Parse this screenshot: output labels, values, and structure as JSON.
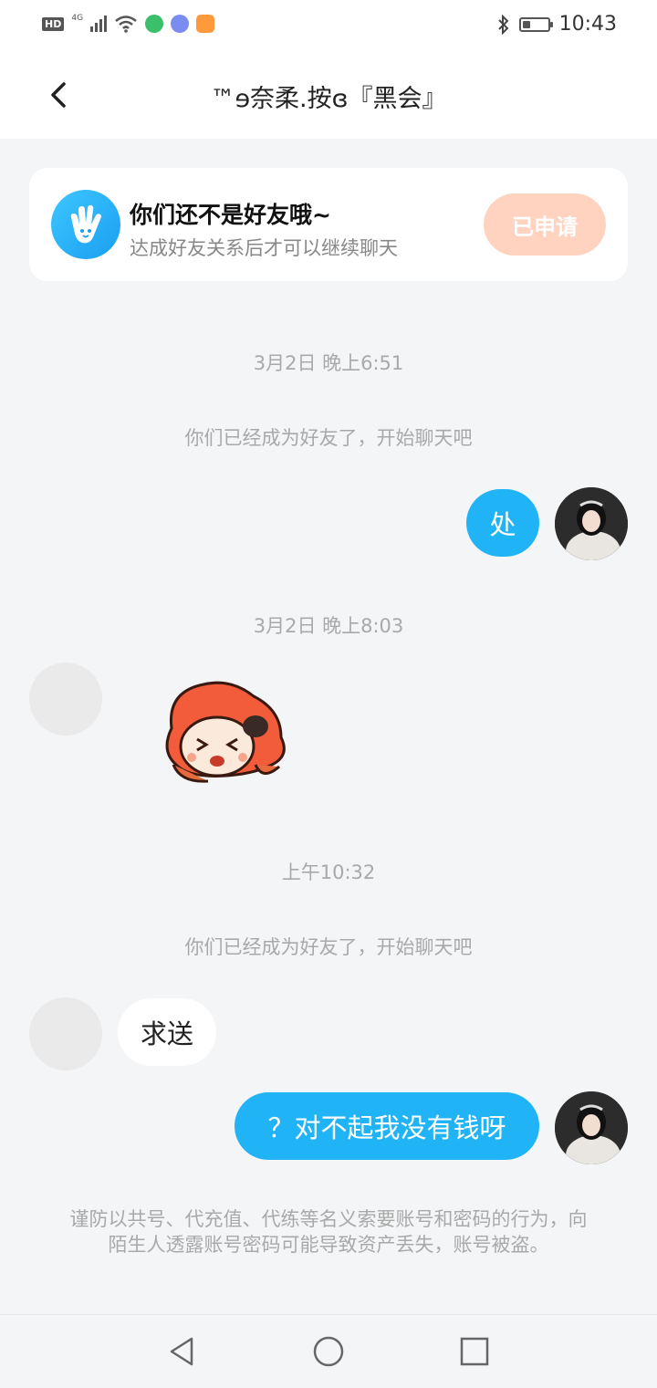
{
  "status_bar": {
    "left_indicators": [
      "HD",
      "4G"
    ],
    "icons": [
      "hd-icon",
      "4g-signal-icon",
      "cellular-signal-icon",
      "wifi-icon",
      "green-app-icon",
      "music-app-icon",
      "video-app-icon"
    ],
    "right_icons": [
      "bluetooth-icon",
      "battery-icon"
    ],
    "battery_level": 0.3,
    "time": "10:43"
  },
  "header": {
    "title": "™ɘ奈柔.按ɞ『黑会』",
    "back_icon": "chevron-left-icon"
  },
  "friend_card": {
    "icon": "waving-hand-icon",
    "title": "你们还不是好友哦~",
    "subtitle": "达成好友关系后才可以继续聊天",
    "button_label": "已申请"
  },
  "messages": [
    {
      "type": "timestamp",
      "text": "3月2日 晚上6:51"
    },
    {
      "type": "system",
      "text": "你们已经成为好友了，开始聊天吧"
    },
    {
      "type": "outgoing",
      "text": "处"
    },
    {
      "type": "timestamp",
      "text": "3月2日 晚上8:03"
    },
    {
      "type": "incoming_sticker",
      "sticker": "cartoon-girl-sticker"
    },
    {
      "type": "timestamp",
      "text": "上午10:32"
    },
    {
      "type": "system",
      "text": "你们已经成为好友了，开始聊天吧"
    },
    {
      "type": "incoming",
      "text": "求送"
    },
    {
      "type": "outgoing",
      "text": "？对不起我没有钱呀"
    }
  ],
  "safety_notice": "谨防以共号、代充值、代练等名义索要账号和密码的行为，向陌生人透露账号密码可能导致资产丢失，账号被盗。",
  "nav_bar": {
    "icons": [
      "back-triangle-icon",
      "home-circle-icon",
      "recents-square-icon"
    ]
  },
  "colors": {
    "accent": "#20b4f6",
    "button_disabled": "#ffd3bf",
    "background": "#f4f5f7",
    "muted_text": "#a9a9a9"
  }
}
